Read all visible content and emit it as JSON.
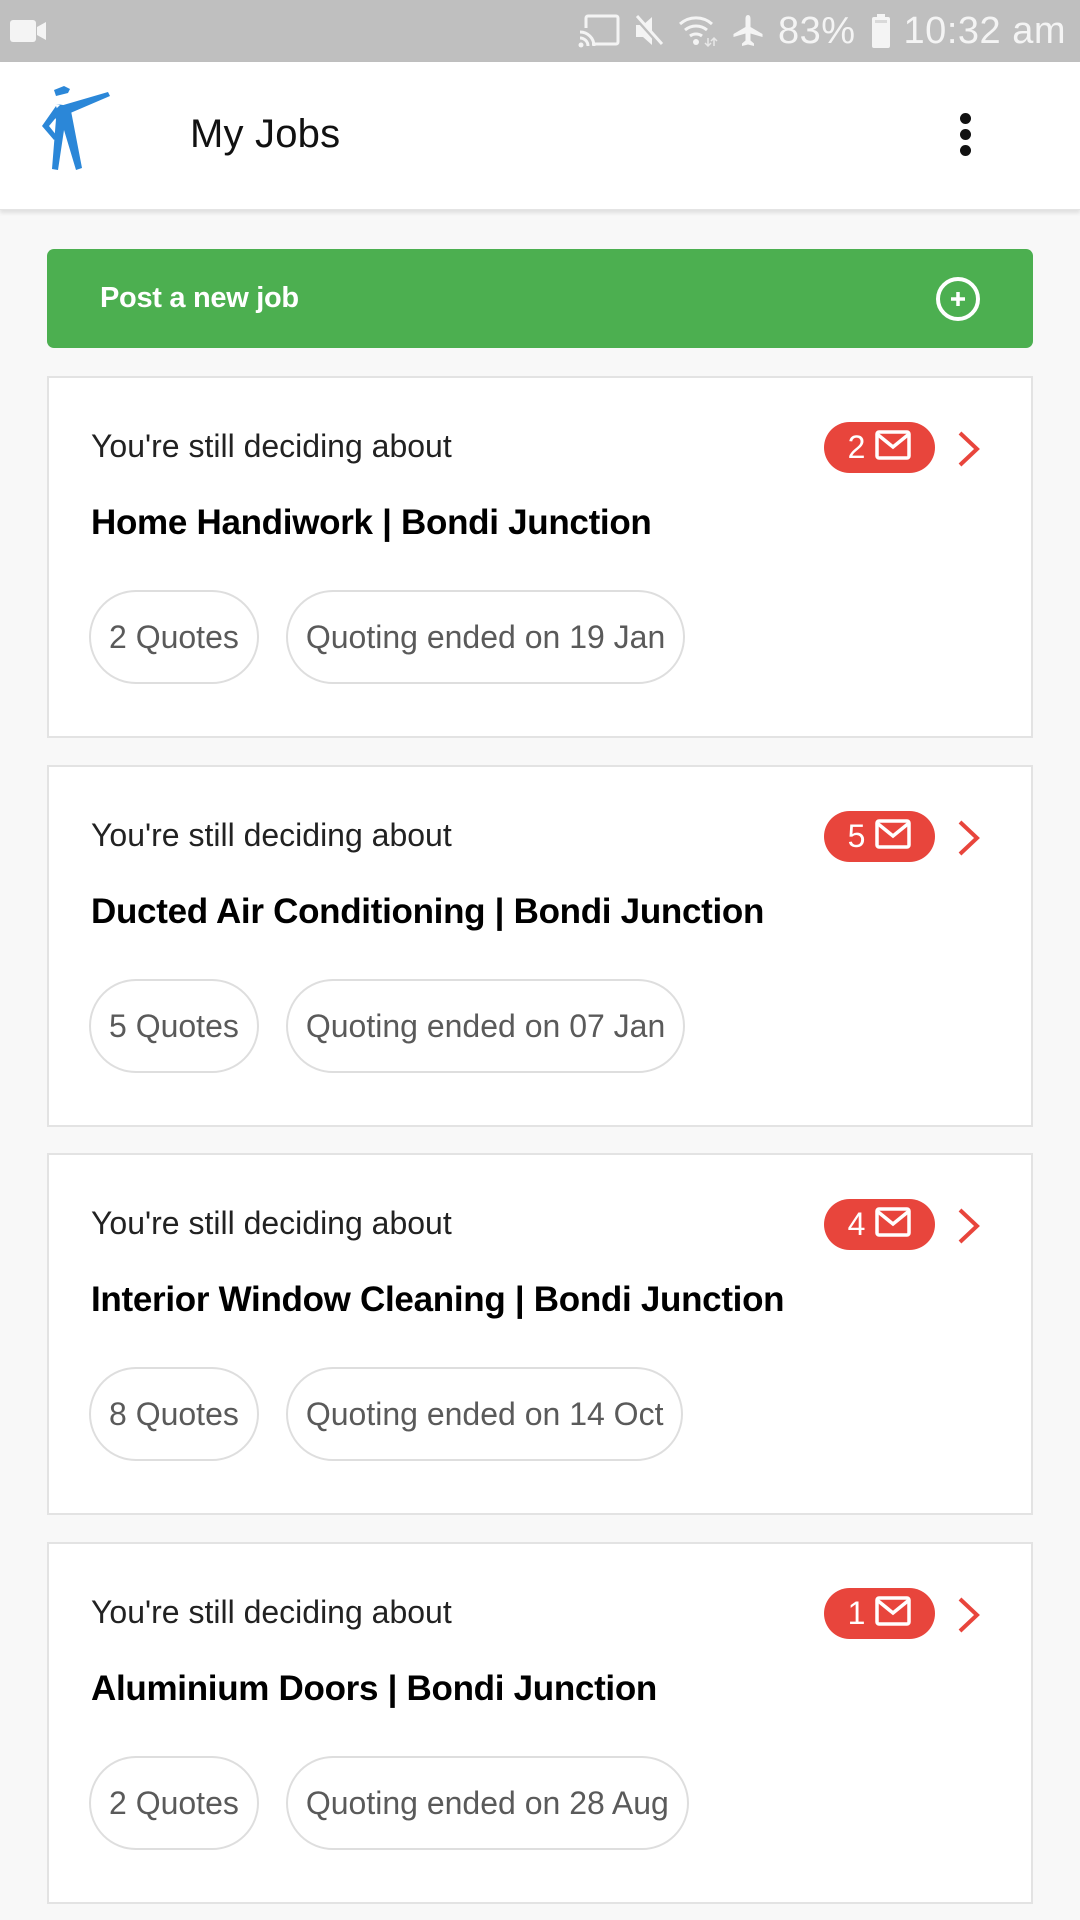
{
  "status_bar": {
    "left_icons": [
      "video-camera-icon"
    ],
    "right_icons": [
      "cast-icon",
      "mute-icon",
      "wifi-icon",
      "airplane-mode-icon"
    ],
    "battery_percent": "83%",
    "battery_icon": "battery-icon",
    "time": "10:32 am"
  },
  "app_bar": {
    "logo_icon": "worker-pointing-logo",
    "title": "My Jobs",
    "menu_icon": "more-vertical-icon"
  },
  "post_job_button": {
    "label": "Post a new job",
    "icon": "add-circle-icon",
    "color": "#4caf50"
  },
  "colors": {
    "badge": "#e8453c",
    "chevron": "#e8453c",
    "chip_border": "#dedede",
    "logo": "#2b87d8"
  },
  "jobs": [
    {
      "status": "You're still deciding about",
      "title": "Home Handiwork | Bondi Junction",
      "unread_messages": "2",
      "quotes": "2 Quotes",
      "quoting_status": "Quoting ended on 19 Jan"
    },
    {
      "status": "You're still deciding about",
      "title": "Ducted Air Conditioning | Bondi Junction",
      "unread_messages": "5",
      "quotes": "5 Quotes",
      "quoting_status": "Quoting ended on 07 Jan"
    },
    {
      "status": "You're still deciding about",
      "title": "Interior Window Cleaning | Bondi Junction",
      "unread_messages": "4",
      "quotes": "8 Quotes",
      "quoting_status": "Quoting ended on 14 Oct"
    },
    {
      "status": "You're still deciding about",
      "title": "Aluminium Doors | Bondi Junction",
      "unread_messages": "1",
      "quotes": "2 Quotes",
      "quoting_status": "Quoting ended on 28 Aug"
    }
  ]
}
